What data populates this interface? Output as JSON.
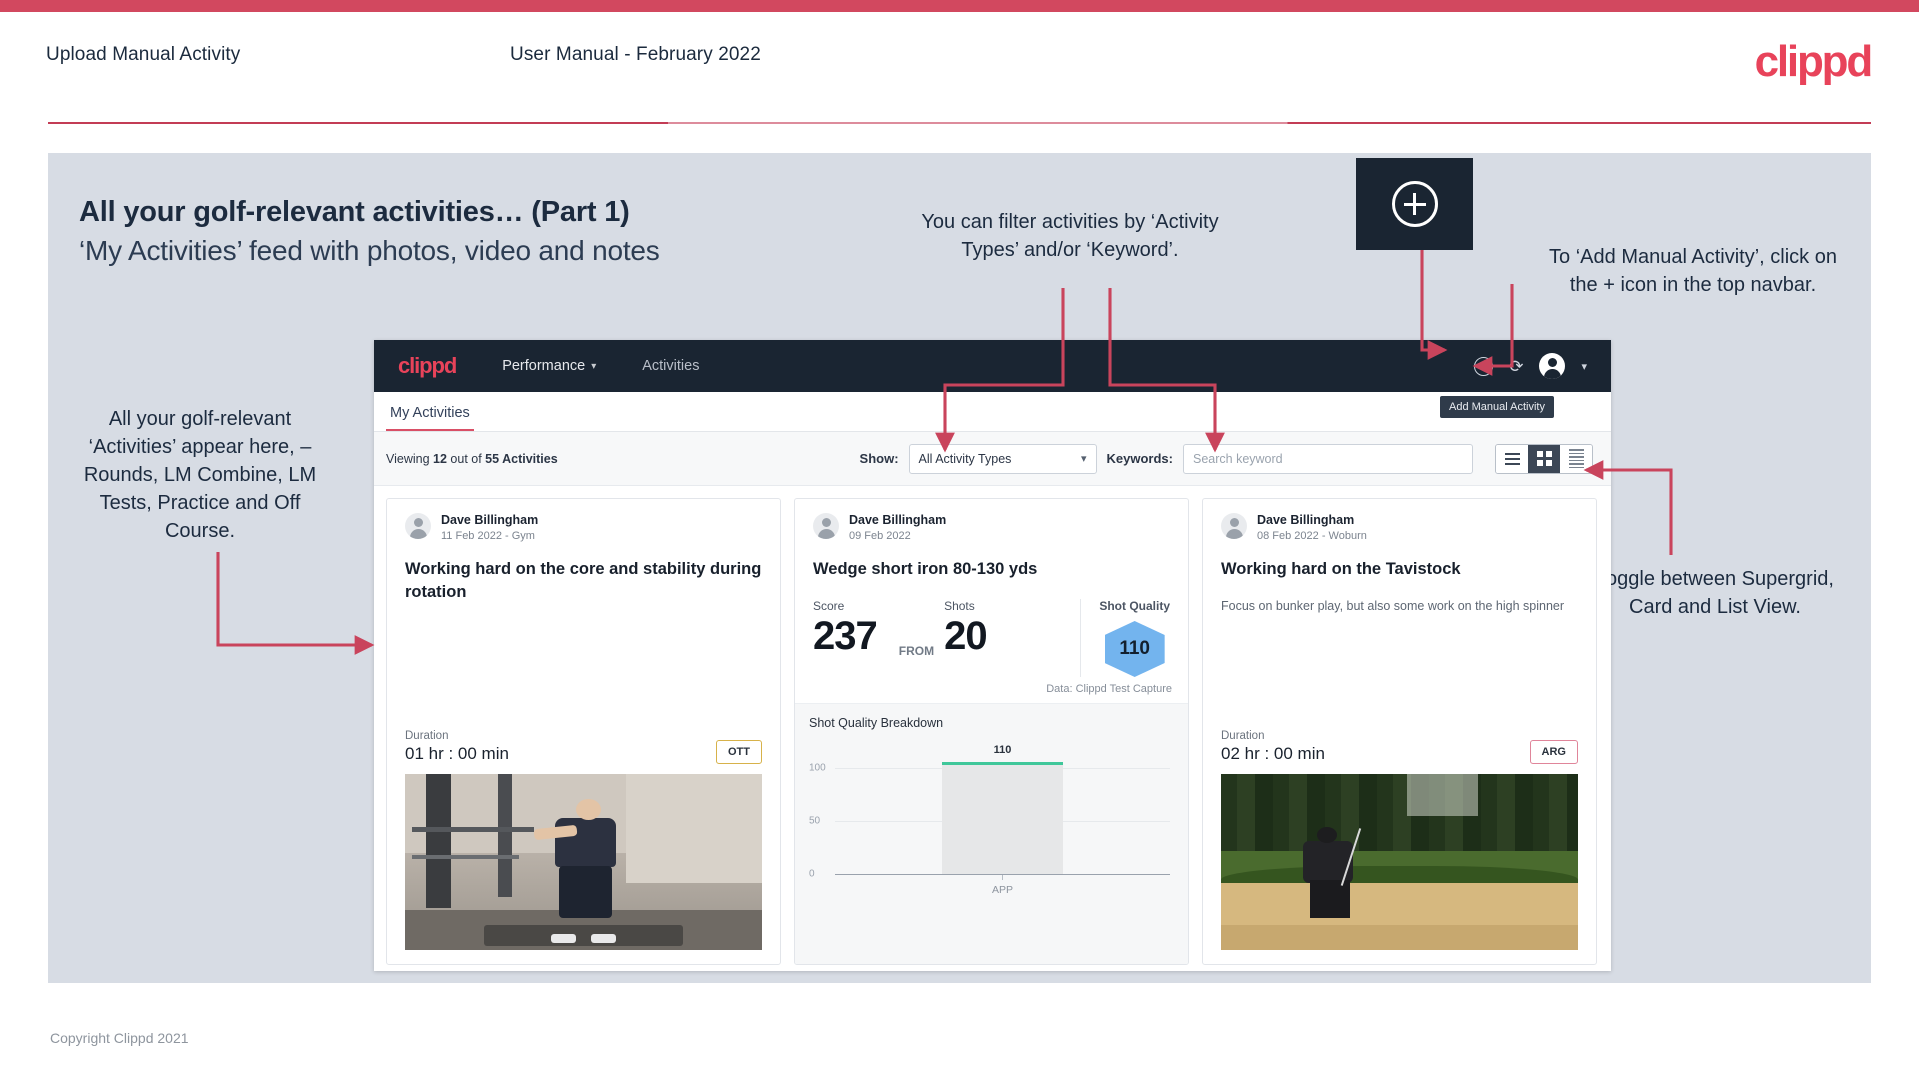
{
  "header": {
    "left_title": "Upload Manual Activity",
    "center_title": "User Manual - February 2022",
    "brand": "clippd"
  },
  "slide": {
    "title_line1": "All your golf-relevant activities… (Part 1)",
    "title_line2": "‘My Activities’ feed with photos, video and notes"
  },
  "annotations": {
    "filter": "You can filter activities by ‘Activity Types’ and/or ‘Keyword’.",
    "add_manual": "To ‘Add Manual Activity’, click on the + icon in the top navbar.",
    "activities_feed": "All your golf-relevant ‘Activities’ appear here, – Rounds, LM Combine, LM Tests, Practice and Off Course.",
    "toggle_views": "Toggle between Supergrid, Card and List View.",
    "plus_icon_name": "plus-circle-icon"
  },
  "app": {
    "navbar": {
      "brand": "clippd",
      "links": [
        {
          "label": "Performance",
          "has_caret": true
        },
        {
          "label": "Activities",
          "has_caret": false
        }
      ],
      "icons": [
        "add-circle-icon",
        "refresh-icon",
        "account-avatar-icon",
        "chevron-down-icon"
      ],
      "tooltip": "Add Manual Activity"
    },
    "tabs": [
      {
        "label": "My Activities",
        "active": true
      }
    ],
    "filterbar": {
      "viewing_prefix": "Viewing ",
      "viewing_count": "12",
      "viewing_mid": " out of ",
      "viewing_total": "55 Activities",
      "show_label": "Show:",
      "activity_type_value": "All Activity Types",
      "keywords_label": "Keywords:",
      "search_placeholder": "Search keyword",
      "view_buttons": [
        "list-view-icon",
        "supergrid-view-icon",
        "card-view-icon"
      ],
      "active_view": "supergrid-view-icon"
    },
    "cards": [
      {
        "user": "Dave Billingham",
        "meta": "11 Feb 2022 - Gym",
        "title": "Working hard on the core and stability during rotation",
        "note": "",
        "duration_label": "Duration",
        "duration_value": "01 hr : 00 min",
        "chip": "OTT",
        "chip_color": "#d7b24a",
        "media": "gym-video-thumbnail"
      },
      {
        "user": "Dave Billingham",
        "meta": "09 Feb 2022",
        "title": "Wedge short iron 80-130 yds",
        "score_label": "Score",
        "score_value": "237",
        "from_label": "FROM",
        "shots_label": "Shots",
        "shots_value": "20",
        "shot_quality_label": "Shot Quality",
        "shot_quality_value": "110",
        "data_source": "Data: Clippd Test Capture"
      },
      {
        "user": "Dave Billingham",
        "meta": "08 Feb 2022 - Woburn",
        "title": "Working hard on the Tavistock",
        "note": "Focus on bunker play, but also some work on the high spinner",
        "duration_label": "Duration",
        "duration_value": "02 hr : 00 min",
        "chip": "ARG",
        "chip_color": "#e0859a",
        "media": "bunker-photo-thumbnail"
      }
    ]
  },
  "chart_data": {
    "type": "bar",
    "title": "Shot Quality Breakdown",
    "categories": [
      "APP"
    ],
    "values": [
      110
    ],
    "data_labels": [
      "110"
    ],
    "ylabel": "",
    "xlabel": "",
    "yticks": [
      "0",
      "50",
      "100"
    ],
    "ylim": [
      0,
      130
    ],
    "grid": true,
    "legend": false,
    "bar_color": "#e6e7e8",
    "bar_top_color": "#3fc79a"
  },
  "footer": {
    "copyright": "Copyright Clippd 2021"
  },
  "colors": {
    "accent": "#d2485f",
    "brand": "#e8435a",
    "panel": "#d7dce4",
    "navy": "#1a2532"
  }
}
